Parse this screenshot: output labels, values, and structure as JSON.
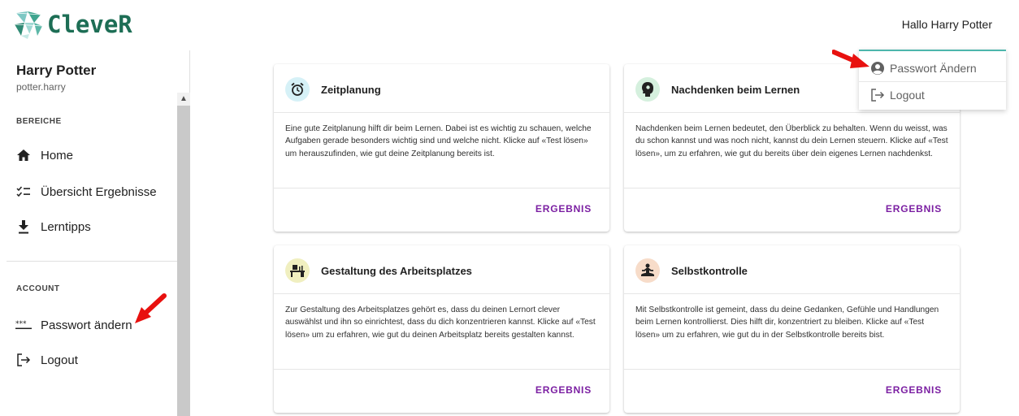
{
  "brand": {
    "name": "CleveR"
  },
  "header": {
    "greeting": "Hallo Harry Potter"
  },
  "user": {
    "name": "Harry Potter",
    "login": "potter.harry"
  },
  "sidebar": {
    "section_areas": "BEREICHE",
    "items": [
      {
        "label": "Home",
        "icon": "home-icon"
      },
      {
        "label": "Übersicht Ergebnisse",
        "icon": "checklist-icon"
      },
      {
        "label": "Lerntipps",
        "icon": "download-icon"
      }
    ],
    "section_account": "ACCOUNT",
    "account_items": [
      {
        "label": "Passwort ändern",
        "icon": "password-icon"
      },
      {
        "label": "Logout",
        "icon": "logout-icon"
      }
    ]
  },
  "cards": [
    {
      "title": "Zeitplanung",
      "icon": "alarm-clock-icon",
      "text": "Eine gute Zeitplanung hilft dir beim Lernen. Dabei ist es wichtig zu schauen, welche Aufgaben gerade besonders wichtig sind und welche nicht. Klicke auf «Test lösen» um herauszufinden, wie gut deine Zeitplanung bereits ist.",
      "button": "ERGEBNIS",
      "icon_bg": "#d6f1f7"
    },
    {
      "title": "Nachdenken beim Lernen",
      "icon": "head-gear-icon",
      "text": "Nachdenken beim Lernen bedeutet, den Überblick zu behalten. Wenn du weisst, was du schon kannst und was noch nicht, kannst du dein Lernen steuern. Klicke auf «Test lösen», um zu erfahren, wie gut du bereits über dein eigenes Lernen nachdenkst.",
      "button": "ERGEBNIS",
      "icon_bg": "#d5f0de"
    },
    {
      "title": "Gestaltung des Arbeitsplatzes",
      "icon": "desk-icon",
      "text": "Zur Gestaltung des Arbeitsplatzes gehört es, dass du deinen Lernort clever auswählst und ihn so einrichtest, dass du dich konzentrieren kannst. Klicke auf «Test lösen» um zu erfahren, wie gut du deinen Arbeitsplatz bereits gestalten kannst.",
      "button": "ERGEBNIS",
      "icon_bg": "#f0efc0"
    },
    {
      "title": "Selbstkontrolle",
      "icon": "meditation-icon",
      "text": "Mit Selbstkontrolle ist gemeint, dass du deine Gedanken, Gefühle und Handlungen beim Lernen kontrollierst. Dies hilft dir, konzentriert zu bleiben. Klicke auf «Test lösen» um zu erfahren, wie gut du in der Selbstkontrolle bereits bist.",
      "button": "ERGEBNIS",
      "icon_bg": "#f7dcc9"
    }
  ],
  "dropdown": {
    "items": [
      {
        "label": "Passwort Ändern",
        "icon": "account-circle-icon"
      },
      {
        "label": "Logout",
        "icon": "logout-icon"
      }
    ]
  },
  "colors": {
    "accent": "#7b1fa2",
    "brand": "#1d6e55",
    "annotation_arrow": "#e8110f",
    "dropdown_border": "#4db6ac"
  }
}
